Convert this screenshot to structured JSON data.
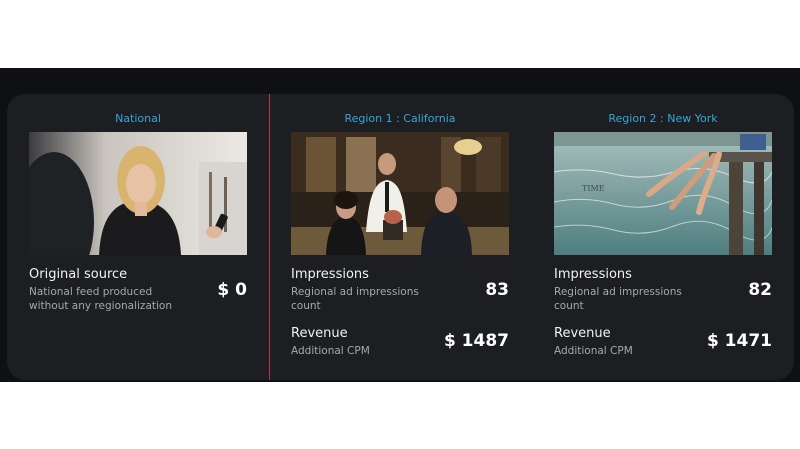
{
  "national": {
    "title": "National",
    "metric": {
      "label": "Original source",
      "description": "National feed produced without any regionalization",
      "value": "$ 0"
    }
  },
  "regions": [
    {
      "title": "Region 1 : California",
      "impressions": {
        "label": "Impressions",
        "description": "Regional ad impressions count",
        "value": "83"
      },
      "revenue": {
        "label": "Revenue",
        "description": "Additional CPM",
        "value": "$ 1487"
      }
    },
    {
      "title": "Region 2 : New York",
      "thumb_text": "TIME",
      "impressions": {
        "label": "Impressions",
        "description": "Regional ad impressions count",
        "value": "82"
      },
      "revenue": {
        "label": "Revenue",
        "description": "Additional CPM",
        "value": "$ 1471"
      }
    }
  ],
  "colors": {
    "accent": "#33a7d8",
    "divider": "#b8324a",
    "panel": "#1d1e22"
  }
}
